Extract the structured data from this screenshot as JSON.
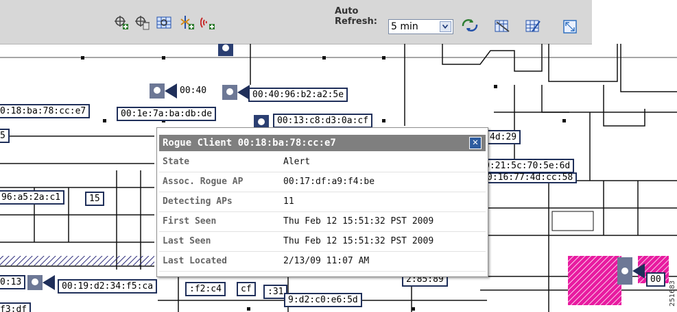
{
  "toolbar": {
    "icons": [
      "add-marker-icon",
      "add-trash-icon",
      "grid-icon",
      "filter-add-icon",
      "signal-add-icon"
    ],
    "auto_refresh_label_line1": "Auto",
    "auto_refresh_label_line2": "Refresh:",
    "auto_refresh_value": "5 min",
    "right_icons": [
      "refresh-tools-icon",
      "building-zoom-icon",
      "grid-edit-icon",
      "fullscreen-icon"
    ]
  },
  "map": {
    "tags": [
      "00:40",
      "00:40:96:b2:a2:5e",
      "0:18:ba:78:cc:e7",
      "00:1e:7a:ba:db:de",
      "00:13:c8:d3:0a:cf",
      "5",
      "4d:29",
      "0:21:5c:70:5e:6d",
      "0:16:77:4d:cc:58",
      "96:a5:2a:c1",
      "15",
      "0:13",
      "00:19:d2:34:f5:ca",
      ":f2:c4",
      "cf",
      ":31",
      "2:85:89",
      "9:d2:c0:e6:5d",
      "00",
      "f3:df"
    ]
  },
  "popup": {
    "title": "Rogue Client 00:18:ba:78:cc:e7",
    "rows": [
      {
        "label": "State",
        "value": "Alert"
      },
      {
        "label": "Assoc. Rogue AP",
        "value": "00:17:df:a9:f4:be"
      },
      {
        "label": "Detecting APs",
        "value": "11"
      },
      {
        "label": "First Seen",
        "value": "Thu Feb 12 15:51:32 PST 2009"
      },
      {
        "label": "Last Seen",
        "value": "Thu Feb 12 15:51:32 PST 2009"
      },
      {
        "label": "Last Located",
        "value": "2/13/09 11:07 AM"
      }
    ]
  },
  "figure_code": "251683"
}
